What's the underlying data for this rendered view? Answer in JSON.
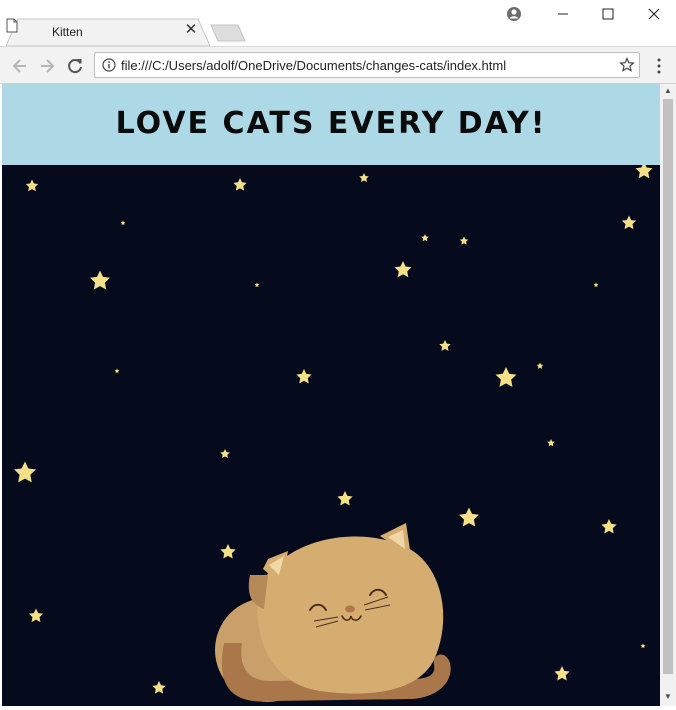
{
  "browser": {
    "tab_title": "Kitten",
    "tab_close_glyph": "✕",
    "url": "file:///C:/Users/adolf/OneDrive/Documents/changes-cats/index.html",
    "window_controls": {
      "minimize": "—",
      "maximize": "☐",
      "close": "✕"
    },
    "icons": [
      "file-icon",
      "account-icon",
      "back-icon",
      "forward-icon",
      "reload-icon",
      "info-icon",
      "bookmark-star-icon",
      "menu-icon"
    ]
  },
  "page": {
    "title": "Love cats every day!",
    "header_color": "#add8e6",
    "sky_color": "#050a1c",
    "star_color": "#f5df87"
  }
}
